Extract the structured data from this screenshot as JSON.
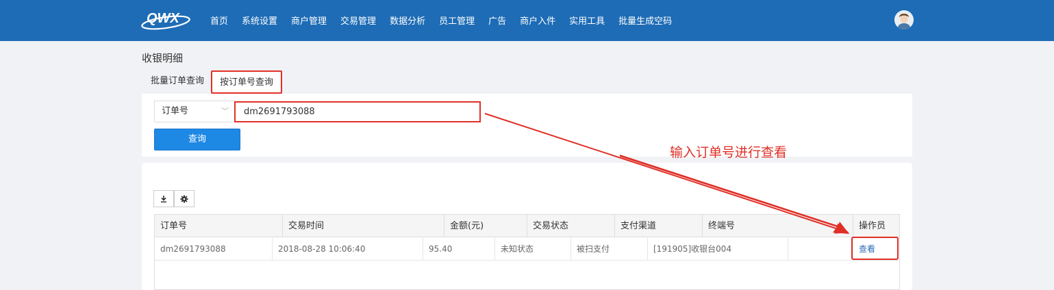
{
  "header": {
    "logo_text": "QWX",
    "nav": [
      "首页",
      "系统设置",
      "商户管理",
      "交易管理",
      "数据分析",
      "员工管理",
      "广告",
      "商户入件",
      "实用工具",
      "批量生成空码"
    ]
  },
  "page": {
    "title": "收银明细",
    "tabs": {
      "batch": "批量订单查询",
      "by_order": "按订单号查询"
    }
  },
  "search": {
    "select_value": "订单号",
    "order_value": "dm2691793088",
    "query_label": "查询"
  },
  "annotation": "输入订单号进行查看",
  "table": {
    "columns": [
      "订单号",
      "交易时间",
      "金额(元)",
      "交易状态",
      "支付渠道",
      "终端号",
      "操作员"
    ],
    "rows": [
      {
        "order_no": "dm2691793088",
        "time": "2018-08-28 10:06:40",
        "amount": "95.40",
        "status": "未知状态",
        "channel": "被扫支付",
        "terminal": "[191905]收银台004",
        "operator": "",
        "action": "查看"
      }
    ]
  },
  "colors": {
    "topbar": "#1e6cb6",
    "highlight": "#e02f26",
    "primary_button": "#1e88e5"
  }
}
